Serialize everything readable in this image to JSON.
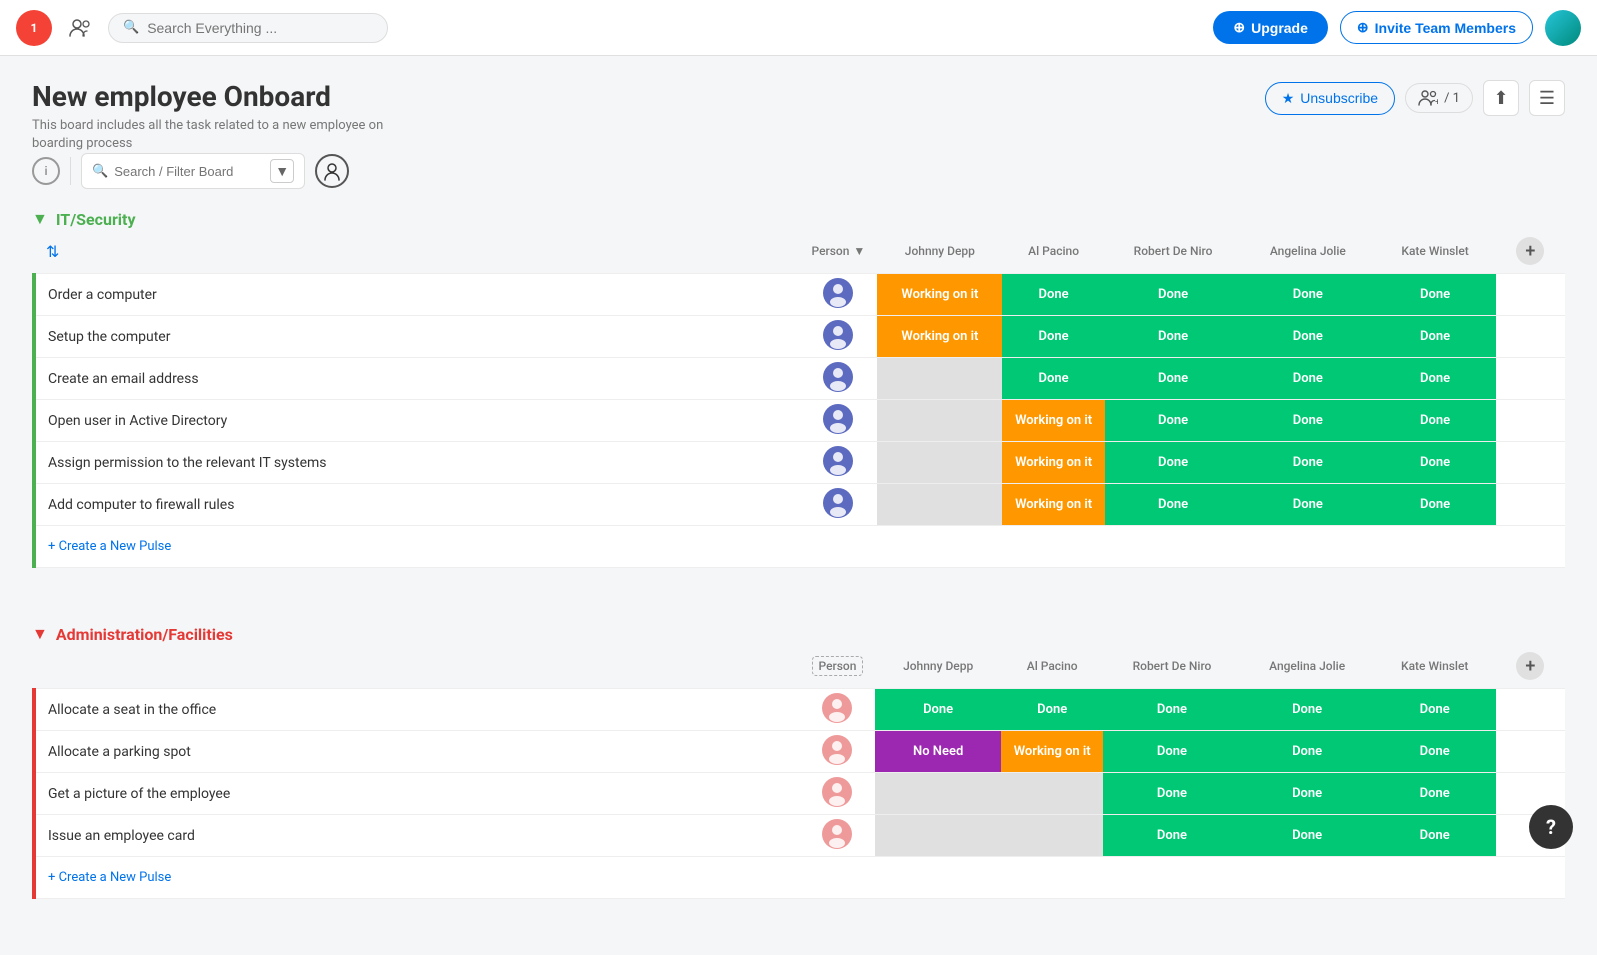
{
  "topnav": {
    "notification_count": "1",
    "search_placeholder": "Search Everything ...",
    "upgrade_label": "Upgrade",
    "invite_label": "Invite Team Members"
  },
  "board": {
    "title": "New employee Onboard",
    "description": "This board includes all the task related to a new employee on boarding process",
    "unsubscribe_label": "Unsubscribe",
    "members_count": "/ 1",
    "filter_placeholder": "Search / Filter Board"
  },
  "groups": [
    {
      "id": "it-security",
      "title": "IT/Security",
      "color": "green",
      "columns": [
        "Person",
        "Johnny Depp",
        "Al Pacino",
        "Robert De Niro",
        "Angelina Jolie",
        "Kate Winslet"
      ],
      "rows": [
        {
          "task": "Order a computer",
          "statuses": [
            "working",
            "done",
            "done",
            "done",
            "done"
          ]
        },
        {
          "task": "Setup the computer",
          "statuses": [
            "working",
            "done",
            "done",
            "done",
            "done"
          ]
        },
        {
          "task": "Create an email address",
          "statuses": [
            "empty",
            "done",
            "done",
            "done",
            "done"
          ]
        },
        {
          "task": "Open user in Active Directory",
          "statuses": [
            "empty",
            "working",
            "done",
            "done",
            "done"
          ]
        },
        {
          "task": "Assign permission to the relevant IT systems",
          "statuses": [
            "empty",
            "working",
            "done",
            "done",
            "done"
          ]
        },
        {
          "task": "Add computer to firewall rules",
          "statuses": [
            "empty",
            "working",
            "done",
            "done",
            "done"
          ]
        }
      ],
      "create_pulse_label": "+ Create a New Pulse"
    },
    {
      "id": "admin-facilities",
      "title": "Administration/Facilities",
      "color": "red",
      "columns": [
        "Person",
        "Johnny Depp",
        "Al Pacino",
        "Robert De Niro",
        "Angelina Jolie",
        "Kate Winslet"
      ],
      "rows": [
        {
          "task": "Allocate a seat in the office",
          "statuses": [
            "done",
            "done",
            "done",
            "done",
            "done"
          ]
        },
        {
          "task": "Allocate a parking spot",
          "statuses": [
            "noneed",
            "working",
            "done",
            "done",
            "done"
          ]
        },
        {
          "task": "Get a picture of the employee",
          "statuses": [
            "empty",
            "empty",
            "done",
            "done",
            "done"
          ]
        },
        {
          "task": "Issue an employee card",
          "statuses": [
            "empty",
            "empty",
            "done",
            "done",
            "done"
          ]
        }
      ],
      "create_pulse_label": "+ Create a New Pulse"
    }
  ],
  "status_labels": {
    "working": "Working on it",
    "done": "Done",
    "noneed": "No Need",
    "empty": ""
  },
  "help_label": "?",
  "icons": {
    "chevron_down": "▼",
    "plus": "+",
    "search": "🔍",
    "star": "★",
    "sort": "⇅",
    "hamburger": "☰",
    "upload": "⬆",
    "circle_plus": "⊕",
    "people": "👥",
    "person_filter": "👤"
  }
}
